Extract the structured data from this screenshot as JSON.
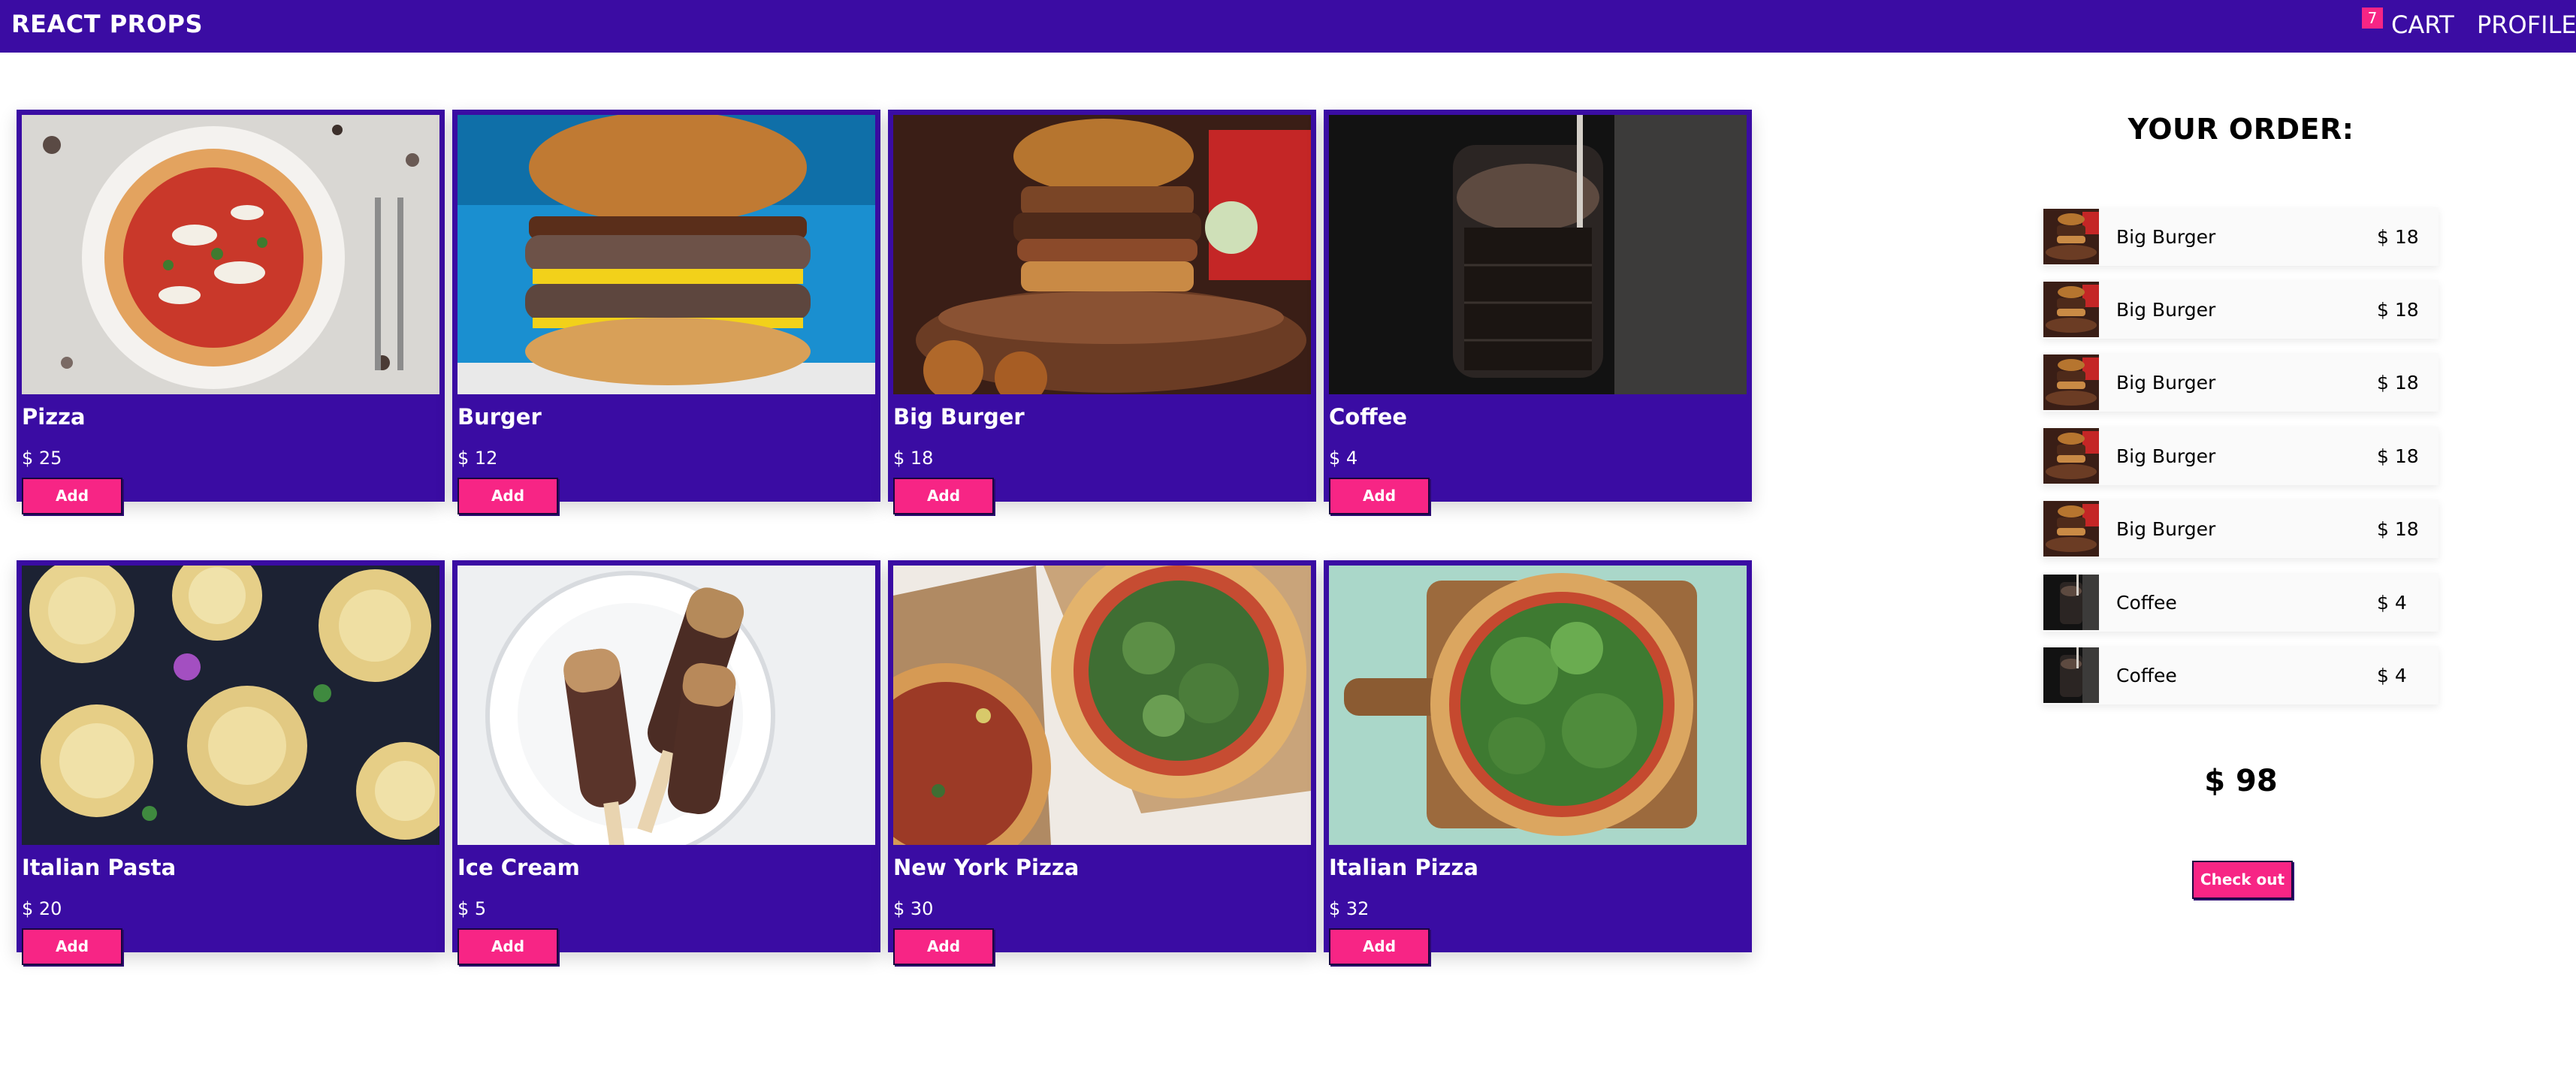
{
  "nav": {
    "brand": "REACT PROPS",
    "cart_count": "7",
    "cart_label": "CART",
    "profile_label": "PROFILE"
  },
  "colors": {
    "nav": "#3b0ca3",
    "card": "#3a0ca3",
    "accent": "#f72585"
  },
  "products": [
    {
      "name": "Pizza",
      "price": "$ 25",
      "add_label": "Add",
      "image": "pizza"
    },
    {
      "name": "Burger",
      "price": "$ 12",
      "add_label": "Add",
      "image": "burger"
    },
    {
      "name": "Big Burger",
      "price": "$ 18",
      "add_label": "Add",
      "image": "big-burger"
    },
    {
      "name": "Coffee",
      "price": "$ 4",
      "add_label": "Add",
      "image": "coffee"
    },
    {
      "name": "Italian Pasta",
      "price": "$ 20",
      "add_label": "Add",
      "image": "pasta"
    },
    {
      "name": "Ice Cream",
      "price": "$ 5",
      "add_label": "Add",
      "image": "ice-cream"
    },
    {
      "name": "New York Pizza",
      "price": "$ 30",
      "add_label": "Add",
      "image": "ny-pizza"
    },
    {
      "name": "Italian Pizza",
      "price": "$ 32",
      "add_label": "Add",
      "image": "italian-pizza"
    }
  ],
  "order": {
    "title": "YOUR ORDER:",
    "items": [
      {
        "name": "Big Burger",
        "price": "$ 18",
        "image": "big-burger"
      },
      {
        "name": "Big Burger",
        "price": "$ 18",
        "image": "big-burger"
      },
      {
        "name": "Big Burger",
        "price": "$ 18",
        "image": "big-burger"
      },
      {
        "name": "Big Burger",
        "price": "$ 18",
        "image": "big-burger"
      },
      {
        "name": "Big Burger",
        "price": "$ 18",
        "image": "big-burger"
      },
      {
        "name": "Coffee",
        "price": "$ 4",
        "image": "coffee"
      },
      {
        "name": "Coffee",
        "price": "$ 4",
        "image": "coffee"
      }
    ],
    "total": "$ 98",
    "checkout_label": "Check out"
  }
}
